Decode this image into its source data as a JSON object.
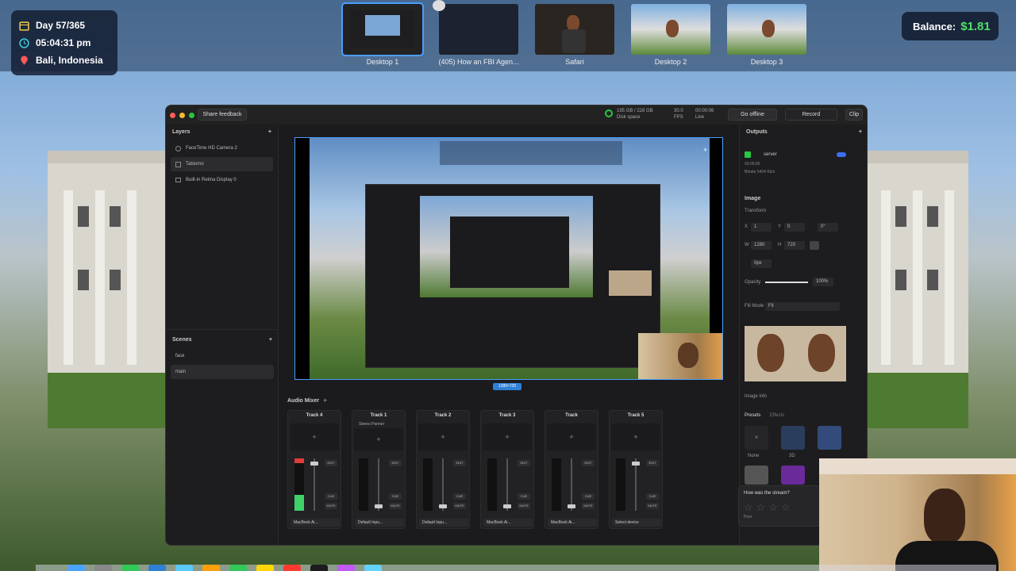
{
  "desktops": [
    {
      "label": "Desktop 1",
      "active": true
    },
    {
      "label": "(405) How an FBI Agen...",
      "active": false
    },
    {
      "label": "Safari",
      "active": false
    },
    {
      "label": "Desktop 2",
      "active": false
    },
    {
      "label": "Desktop 3",
      "active": false
    }
  ],
  "info": {
    "day": "Day 57/365",
    "time": "05:04:31 pm",
    "location": "Bali, Indonesia"
  },
  "balance": {
    "label": "Balance:",
    "amount": "$1.81"
  },
  "app": {
    "share_feedback": "Share feedback",
    "disk": "195 GB / 228 GB",
    "disk_label": "Disk space",
    "fps": "30.0",
    "fps_label": "FPS",
    "live_time": "00:00:06",
    "live_label": "Live",
    "go_offline": "Go offline",
    "record": "Record",
    "clip": "Clip",
    "layers_title": "Layers",
    "layers": [
      {
        "label": "FaceTime HD Camera 2",
        "selected": false
      },
      {
        "label": "Tabiomo",
        "selected": true
      },
      {
        "label": "Built-in Retina Display 0",
        "selected": false
      }
    ],
    "scenes_title": "Scenes",
    "scenes": [
      {
        "label": "face",
        "selected": false
      },
      {
        "label": "main",
        "selected": true
      }
    ],
    "resolution": "1280×720",
    "outputs_title": "Outputs",
    "output_name": "server",
    "output_time": "00:00:06",
    "output_bitrate": "Bitrate 5404 Kb/s",
    "image_title": "Image",
    "transform_label": "Transform",
    "x_label": "X",
    "x_value": "1",
    "y_label": "Y",
    "y_value": "0",
    "rotation_value": "0°",
    "w_label": "W",
    "w_value": "1280",
    "h_label": "H",
    "h_value": "720",
    "radius_value": "0px",
    "opacity_label": "Opacity",
    "opacity_value": "100%",
    "fill_mode_label": "Fill Mode",
    "fill_mode_value": "Fit",
    "image_info": "Image info",
    "presets_tab": "Presets",
    "effects_tab": "Effects",
    "preset_none": "None",
    "preset_3d": "3D",
    "audio_mixer_title": "Audio Mixer",
    "tracks": [
      {
        "name": "Track 4",
        "device": "MacBook Ai...",
        "extra": ""
      },
      {
        "name": "Track 1",
        "device": "Default Inpu...",
        "extra": "Stereo Panner"
      },
      {
        "name": "Track 2",
        "device": "Default Inpu...",
        "extra": ""
      },
      {
        "name": "Track 3",
        "device": "MacBook Ai...",
        "extra": ""
      },
      {
        "name": "Track",
        "device": "MacBook Ai...",
        "extra": ""
      },
      {
        "name": "Track 5",
        "device": "Select device",
        "extra": ""
      }
    ],
    "edit": "EDIT",
    "cue": "CUE",
    "mute": "MUTE"
  },
  "rating": {
    "question": "How was the stream?",
    "poor": "Poor"
  },
  "colors": {
    "accent": "#4a9eff",
    "balance_green": "#4ee06a",
    "window_bg": "#1b1b1d"
  }
}
